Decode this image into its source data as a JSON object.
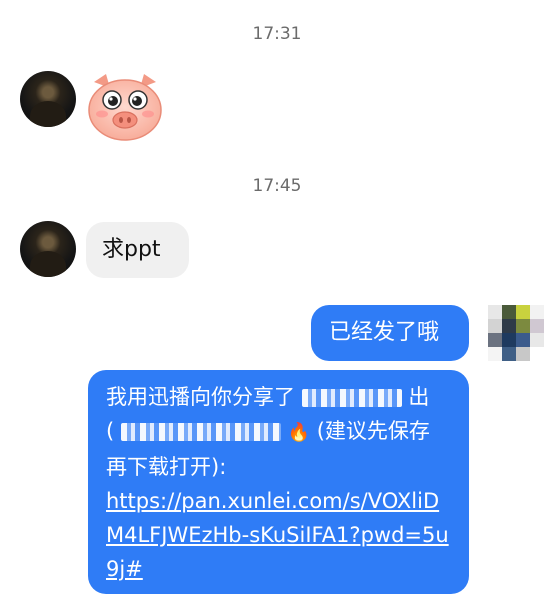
{
  "messages": {
    "time_1": "17:31",
    "time_2": "17:45",
    "request_text": "求ppt",
    "reply_text": "已经发了哦",
    "share_line_1": "我用迅播向你分享了",
    "share_line_1_end": "出",
    "share_paren_open": "(",
    "share_fire": "🔥",
    "share_note": "(建议先保存",
    "share_line_3": "再下载打开):",
    "share_link": "https://pan.xunlei.com/s/VOXliDM4LFJWEzHb-sKuSiIFA1?pwd=5u9j#"
  },
  "icons": {
    "sticker": "pig-face-sticker-icon",
    "fire": "fire-emoji-icon"
  },
  "colors": {
    "outgoing_bubble": "#2f7cf6",
    "incoming_bubble": "#f0f0f0",
    "timestamp": "#6b6b6b"
  }
}
